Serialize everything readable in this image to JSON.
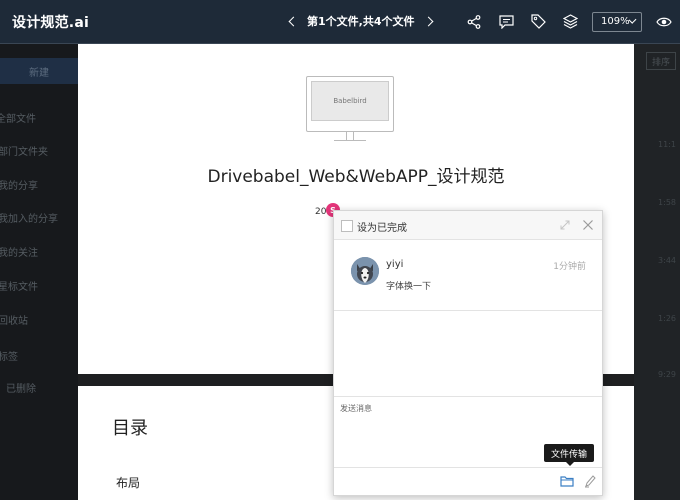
{
  "header": {
    "file_title": "设计规范.ai",
    "pager_text": "第1个文件,共4个文件",
    "zoom_value": "109%"
  },
  "background": {
    "new_button": "新建",
    "nav_items": [
      "全部文件",
      "部门文件夹",
      "我的分享",
      "我加入的分享",
      "我的关注",
      "星标文件",
      "回收站",
      "标签",
      "已删除"
    ],
    "times": [
      "11:1",
      "1:58",
      "3:44",
      "1:26",
      "9:29"
    ],
    "sort_button": "排序"
  },
  "document": {
    "monitor_label": "Babelbird",
    "title": "Drivebabel_Web&WebAPP_设计规范",
    "date_text": "20",
    "badge_letter": "S",
    "toc_title": "目录",
    "toc_first_item": "布局"
  },
  "panel": {
    "mark_complete_label": "设为已完成",
    "comment": {
      "user": "yiyi",
      "time": "1分钟前",
      "text": "字体换一下"
    },
    "input_placeholder": "发送消息",
    "tooltip": "文件传输"
  },
  "colors": {
    "topbar": "#1e2a38",
    "badge": "#e4357a",
    "panel_bg": "#ffffff"
  }
}
